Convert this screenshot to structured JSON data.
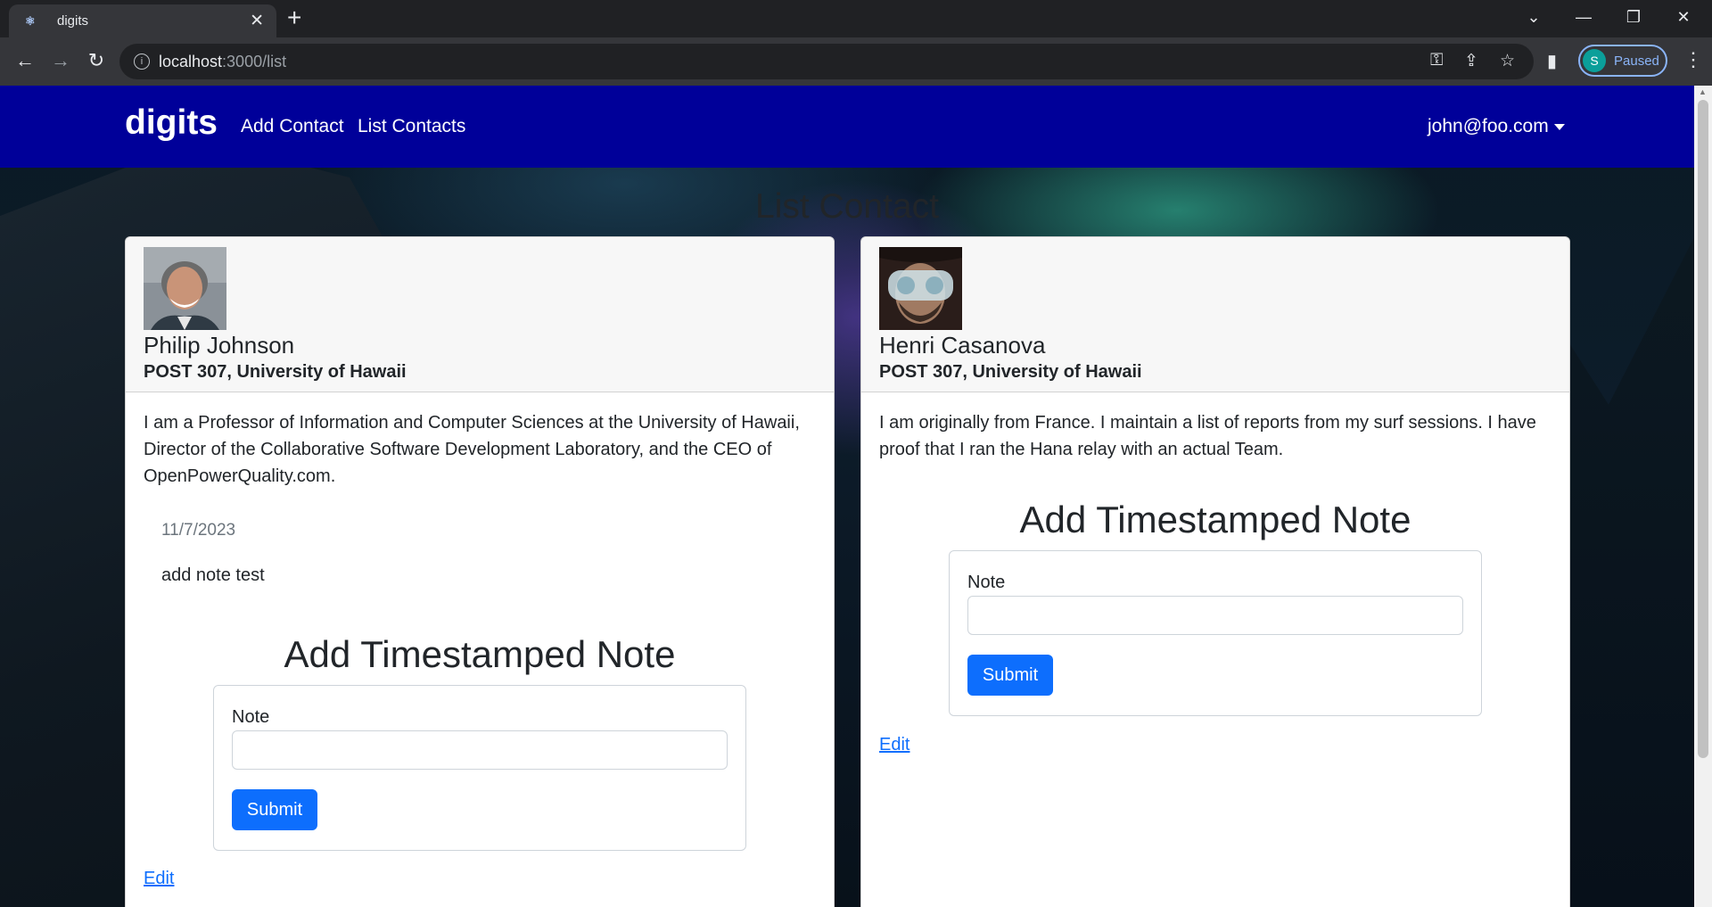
{
  "browser": {
    "tab_title": "digits",
    "tab_close": "✕",
    "new_tab": "+",
    "url_host": "localhost",
    "url_path": ":3000/list",
    "profile_initial": "S",
    "profile_status": "Paused"
  },
  "navbar": {
    "brand": "digits",
    "links": [
      "Add Contact",
      "List Contacts"
    ],
    "user": "john@foo.com"
  },
  "page": {
    "title": "List Contact"
  },
  "contacts": [
    {
      "name": "Philip Johnson",
      "address": "POST 307, University of Hawaii",
      "description": "I am a Professor of Information and Computer Sciences at the University of Hawaii, Director of the Collaborative Software Development Laboratory, and the CEO of OpenPowerQuality.com.",
      "notes": [
        {
          "date": "11/7/2023",
          "text": "add note test"
        }
      ],
      "form_title": "Add Timestamped Note",
      "form_label": "Note",
      "input_value": "",
      "submit_label": "Submit",
      "edit_label": "Edit"
    },
    {
      "name": "Henri Casanova",
      "address": "POST 307, University of Hawaii",
      "description": "I am originally from France. I maintain a list of reports from my surf sessions. I have proof that I ran the Hana relay with an actual Team.",
      "notes": [],
      "form_title": "Add Timestamped Note",
      "form_label": "Note",
      "input_value": "",
      "submit_label": "Submit",
      "edit_label": "Edit"
    }
  ],
  "colors": {
    "navbar": "#000099",
    "button": "#0d6efd",
    "link": "#0d6efd"
  }
}
